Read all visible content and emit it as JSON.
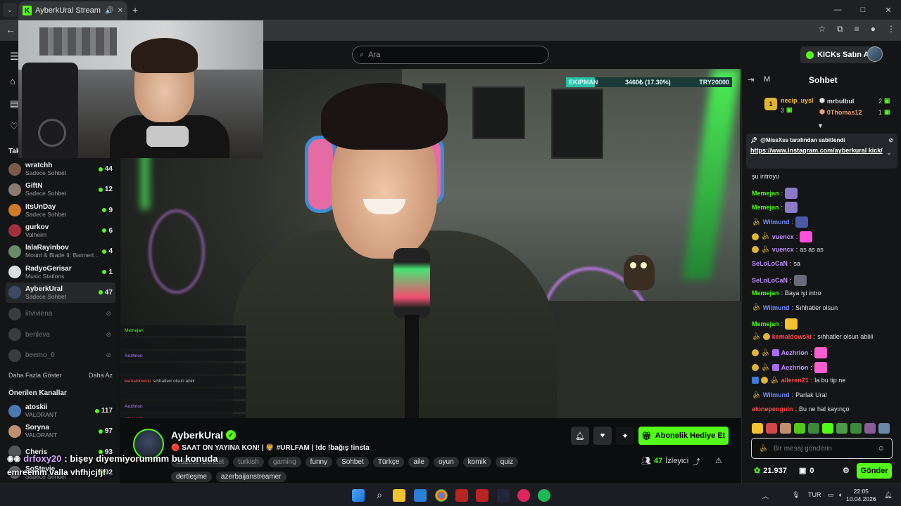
{
  "browser": {
    "tab_title": "AyberkUral Stream - Watch",
    "favicon_letter": "K",
    "new_tab": "+",
    "window_controls": [
      "—",
      "□",
      "✕"
    ]
  },
  "header": {
    "search_placeholder": "Ara",
    "kicks_button": "KICKs Satın Al"
  },
  "sidebar": {
    "section_following": "Tak",
    "following": [
      {
        "name": "wratchh",
        "category": "Sadece Sohbet",
        "viewers": "44",
        "color": "#7a5a4a"
      },
      {
        "name": "GiftN",
        "category": "Sadece Sohbet",
        "viewers": "12",
        "color": "#8a7a70"
      },
      {
        "name": "ItsUnDay",
        "category": "Sadece Sohbet",
        "viewers": "9",
        "color": "#d07a2a"
      },
      {
        "name": "gurkov",
        "category": "Valheim",
        "viewers": "6",
        "color": "#a03040"
      },
      {
        "name": "lalaRayinbov",
        "category": "Mount & Blade II: Bannerl...",
        "viewers": "4",
        "color": "#6a8a6a"
      },
      {
        "name": "RadyoGerisar",
        "category": "Music Stations",
        "viewers": "1",
        "color": "#dddddd"
      },
      {
        "name": "AyberkUral",
        "category": "Sadece Sohbet",
        "viewers": "47",
        "color": "#3d4a62"
      }
    ],
    "offline": [
      "iitviviena",
      "benleva",
      "beemo_0"
    ],
    "show_more": "Daha Fazla Göster",
    "show_less": "Daha Az",
    "section_recommended": "Önerilen Kanallar",
    "recommended": [
      {
        "name": "atoskii",
        "category": "VALORANT",
        "viewers": "117",
        "color": "#4a7ab0"
      },
      {
        "name": "Soryna",
        "category": "VALORANT",
        "viewers": "97",
        "color": "#c09070"
      },
      {
        "name": "Cheris",
        "category": "",
        "viewers": "93",
        "color": "#555555"
      },
      {
        "name": "SoStevie",
        "category": "Sadece Sohbet",
        "viewers": "92",
        "color": "#666666"
      }
    ]
  },
  "video": {
    "goal_name": "EKIPMAN",
    "goal_progress": "3460₺ (17.30%)",
    "goal_fraction": 0.173,
    "goal_target": "TRY20000"
  },
  "mini_chat": [
    {
      "user": "Memejan",
      "text": ""
    },
    {
      "user": "",
      "text": ""
    },
    {
      "user": "Aezhrion",
      "text": ""
    },
    {
      "user": "",
      "text": ""
    },
    {
      "user": "kemaldowski",
      "text": "sıhhatlerr olsun abiiii"
    },
    {
      "user": "",
      "text": ""
    },
    {
      "user": "Aezhrion",
      "text": ""
    },
    {
      "user": "alleren21",
      "text": ""
    }
  ],
  "stream": {
    "streamer": "AyberkUral",
    "title": "🔴 SAAT ON YAYINA KON! | 🦁 #URLFAM | !dc !bağış !insta",
    "tags_faded": [
      "Sadece Sohbet",
      "turkish",
      "gaming"
    ],
    "tags": [
      "funny",
      "Sohbet",
      "Türkçe",
      "aile",
      "oyun",
      "komik",
      "quiz",
      "dertleşme",
      "azerbaijanstreamer"
    ],
    "gift_button": "Abonelik Hediye Et",
    "viewers_count": "47",
    "viewers_label": "İzleyici"
  },
  "overlay_subtitles": [
    ": bişey diyemiyorummm bu konuda",
    "emreemm valla vhfhjcjfjf"
  ],
  "overlay_user": "drfoxy20",
  "chat": {
    "title": "Sohbet",
    "header_letter": "M",
    "leaders": [
      {
        "name": "necip_uysl",
        "count": "3",
        "rank": "1"
      },
      {
        "name": "mrbulbul",
        "count": "2"
      },
      {
        "name": "0Thomas12",
        "count": "1"
      }
    ],
    "pinned_by": "@MissXss tarafından sabitlendi",
    "pinned_link": "https://www.instagram.com/ayberkural kick/",
    "messages": [
      {
        "user": "",
        "text": "şu introyu"
      },
      {
        "user": "Memejan",
        "text": ""
      },
      {
        "user": "Memejan",
        "text": ""
      },
      {
        "user": "Wilmund",
        "text": ""
      },
      {
        "user": "vuencx",
        "text": ""
      },
      {
        "user": "vuencx",
        "text": "as as as"
      },
      {
        "user": "SeLoLoCaN",
        "text": "sa"
      },
      {
        "user": "SeLoLoCaN",
        "text": ""
      },
      {
        "user": "Memejan",
        "text": "Baya iyi intro"
      },
      {
        "user": "Wilmund",
        "text": "Sıhhatler olsun"
      },
      {
        "user": "Memejan",
        "text": ""
      },
      {
        "user": "kemaldowski",
        "text": "sıhhatler olsun abiiii"
      },
      {
        "user": "Aezhrion",
        "text": ""
      },
      {
        "user": "Aezhrion",
        "text": ""
      },
      {
        "user": "alleren21",
        "text": "la bu tip ne"
      },
      {
        "user": "Wilmund",
        "text": "Parlak Ural"
      },
      {
        "user": "alonepenguin",
        "text": "Bu ne hal kayınço"
      }
    ],
    "input_placeholder": "Bir mesaj gönderin",
    "points": "21.937",
    "gifts": "0",
    "send_button": "Gönder"
  },
  "taskbar": {
    "lang": "TUR",
    "time": "22:05",
    "date": "10.04.2026"
  }
}
